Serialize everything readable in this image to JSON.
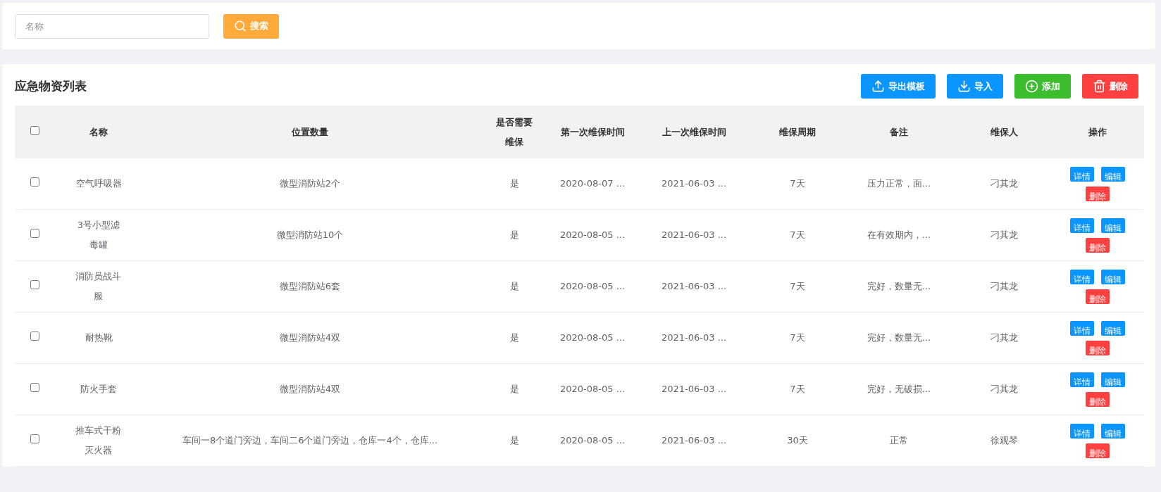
{
  "search": {
    "placeholder": "名称",
    "button": "搜索"
  },
  "list": {
    "title": "应急物资列表",
    "toolbar": [
      {
        "kind": "export",
        "label": "导出模板"
      },
      {
        "kind": "import",
        "label": "导入"
      },
      {
        "kind": "add",
        "label": "添加"
      },
      {
        "kind": "delete",
        "label": "删除"
      }
    ]
  },
  "table": {
    "select_all": {
      "checked": false
    },
    "columns": [
      "名称",
      "位置数量",
      "是否需要维保",
      "第一次维保时间",
      "上一次维保时间",
      "维保周期",
      "备注",
      "维保人",
      "操作"
    ],
    "rows": [
      {
        "checked": false,
        "cells": [
          "空气呼吸器",
          "微型消防站2个",
          "是",
          "2020-08-07 ...",
          "2021-06-03 ...",
          "7天",
          "压力正常，面...",
          "刁其龙"
        ],
        "actions": [
          {
            "kind": "info",
            "label": "详情"
          },
          {
            "kind": "info",
            "label": "编辑"
          },
          {
            "kind": "danger",
            "label": "删除"
          }
        ]
      },
      {
        "checked": false,
        "cells": [
          "3号小型滤毒罐",
          "微型消防站10个",
          "是",
          "2020-08-05 ...",
          "2021-06-03 ...",
          "7天",
          "在有效期内，...",
          "刁其龙"
        ],
        "actions": [
          {
            "kind": "info",
            "label": "详情"
          },
          {
            "kind": "info",
            "label": "编辑"
          },
          {
            "kind": "danger",
            "label": "删除"
          }
        ]
      },
      {
        "checked": false,
        "cells": [
          "消防员战斗服",
          "微型消防站6套",
          "是",
          "2020-08-05 ...",
          "2021-06-03 ...",
          "7天",
          "完好，数量无...",
          "刁其龙"
        ],
        "actions": [
          {
            "kind": "info",
            "label": "详情"
          },
          {
            "kind": "info",
            "label": "编辑"
          },
          {
            "kind": "danger",
            "label": "删除"
          }
        ]
      },
      {
        "checked": false,
        "cells": [
          "耐热靴",
          "微型消防站4双",
          "是",
          "2020-08-05 ...",
          "2021-06-03 ...",
          "7天",
          "完好，数量无...",
          "刁其龙"
        ],
        "actions": [
          {
            "kind": "info",
            "label": "详情"
          },
          {
            "kind": "info",
            "label": "编辑"
          },
          {
            "kind": "danger",
            "label": "删除"
          }
        ]
      },
      {
        "checked": false,
        "cells": [
          "防火手套",
          "微型消防站4双",
          "是",
          "2020-08-05 ...",
          "2021-06-03 ...",
          "7天",
          "完好，无破损...",
          "刁其龙"
        ],
        "actions": [
          {
            "kind": "info",
            "label": "详情"
          },
          {
            "kind": "info",
            "label": "编辑"
          },
          {
            "kind": "danger",
            "label": "删除"
          }
        ]
      },
      {
        "checked": false,
        "cells": [
          "推车式干粉灭火器",
          "车间一8个道门旁边，车间二6个道门旁边，仓库一4个，仓库...",
          "是",
          "2020-08-05 ...",
          "2021-06-03 ...",
          "30天",
          "正常",
          "徐观琴"
        ],
        "actions": [
          {
            "kind": "info",
            "label": "详情"
          },
          {
            "kind": "info",
            "label": "编辑"
          },
          {
            "kind": "danger",
            "label": "删除"
          }
        ]
      }
    ]
  }
}
